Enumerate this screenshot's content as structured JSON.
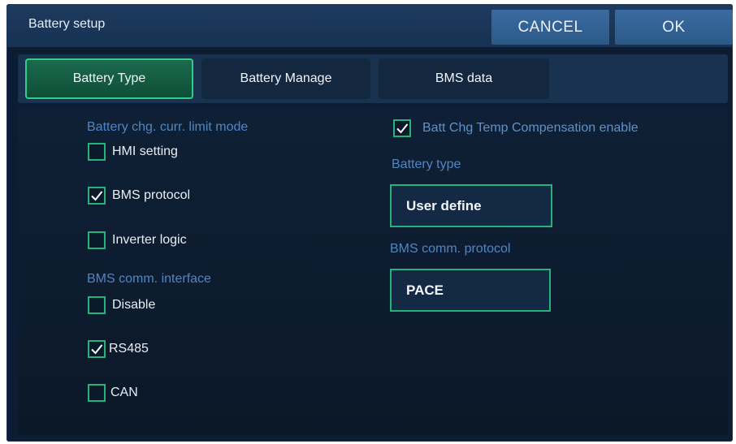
{
  "dialog": {
    "title": "Battery setup",
    "cancel_label": "CANCEL",
    "ok_label": "OK"
  },
  "tabs": [
    {
      "label": "Battery Type",
      "active": true
    },
    {
      "label": "Battery Manage",
      "active": false
    },
    {
      "label": "BMS data",
      "active": false
    }
  ],
  "limit_mode": {
    "label": "Battery chg. curr. limit mode",
    "options": [
      {
        "label": "HMI setting",
        "checked": false
      },
      {
        "label": "BMS protocol",
        "checked": true
      },
      {
        "label": "Inverter logic",
        "checked": false
      }
    ]
  },
  "comm_interface": {
    "label": "BMS comm. interface",
    "options": [
      {
        "label": "Disable",
        "checked": false
      },
      {
        "label": "RS485",
        "checked": true
      },
      {
        "label": "CAN",
        "checked": false
      }
    ]
  },
  "temp_comp": {
    "label": "Batt Chg Temp Compensation enable",
    "checked": true
  },
  "battery_type": {
    "label": "Battery type",
    "value": "User define"
  },
  "bms_protocol": {
    "label": "BMS comm. protocol",
    "value": "PACE"
  },
  "colors": {
    "accent_green": "#26b27a",
    "label_blue": "#4f86c4",
    "button_blue": "#3a6aa0",
    "background": "#0c1d33"
  }
}
